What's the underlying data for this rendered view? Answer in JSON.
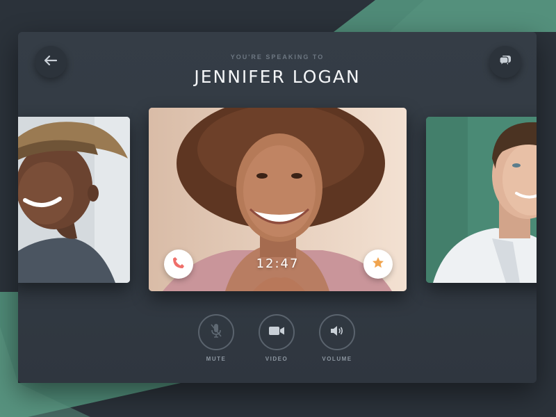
{
  "header": {
    "subtitle": "YOU'RE SPEAKING TO",
    "title": "JENNIFER LOGAN"
  },
  "nav": {
    "back_icon": "arrow-left-icon",
    "chat_icon": "chat-bubbles-icon"
  },
  "call": {
    "timer": "12:47",
    "end_call_icon": "phone-icon",
    "end_call_color": "#ef6f6a",
    "favorite_icon": "star-icon",
    "favorite_color": "#f0a44e"
  },
  "controls": [
    {
      "label": "MUTE",
      "icon": "microphone-muted-icon"
    },
    {
      "label": "VIDEO",
      "icon": "video-camera-icon"
    },
    {
      "label": "VOLUME",
      "icon": "speaker-icon"
    }
  ],
  "colors": {
    "background": "#2b323a",
    "panel": "#343c45",
    "accent_green": "#4f8a77"
  }
}
